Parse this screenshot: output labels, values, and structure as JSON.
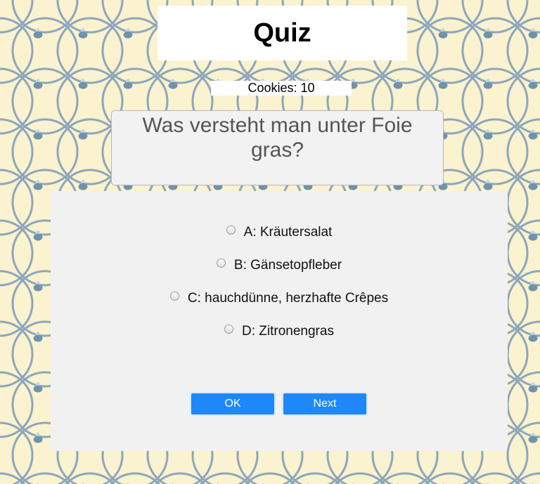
{
  "header": {
    "title": "Quiz"
  },
  "cookies": {
    "label": "Cookies: 10"
  },
  "question": {
    "text": "Was versteht man unter Foie gras?"
  },
  "options": [
    {
      "label": "A: Kräutersalat"
    },
    {
      "label": "B: Gänsetopfleber"
    },
    {
      "label": "C: hauchdünne, herzhafte Crêpes"
    },
    {
      "label": "D: Zitronengras"
    }
  ],
  "buttons": {
    "ok": "OK",
    "next": "Next"
  },
  "colors": {
    "button": "#1e88fb",
    "panel": "#f1f1f1",
    "background": "#fbf2cf"
  }
}
